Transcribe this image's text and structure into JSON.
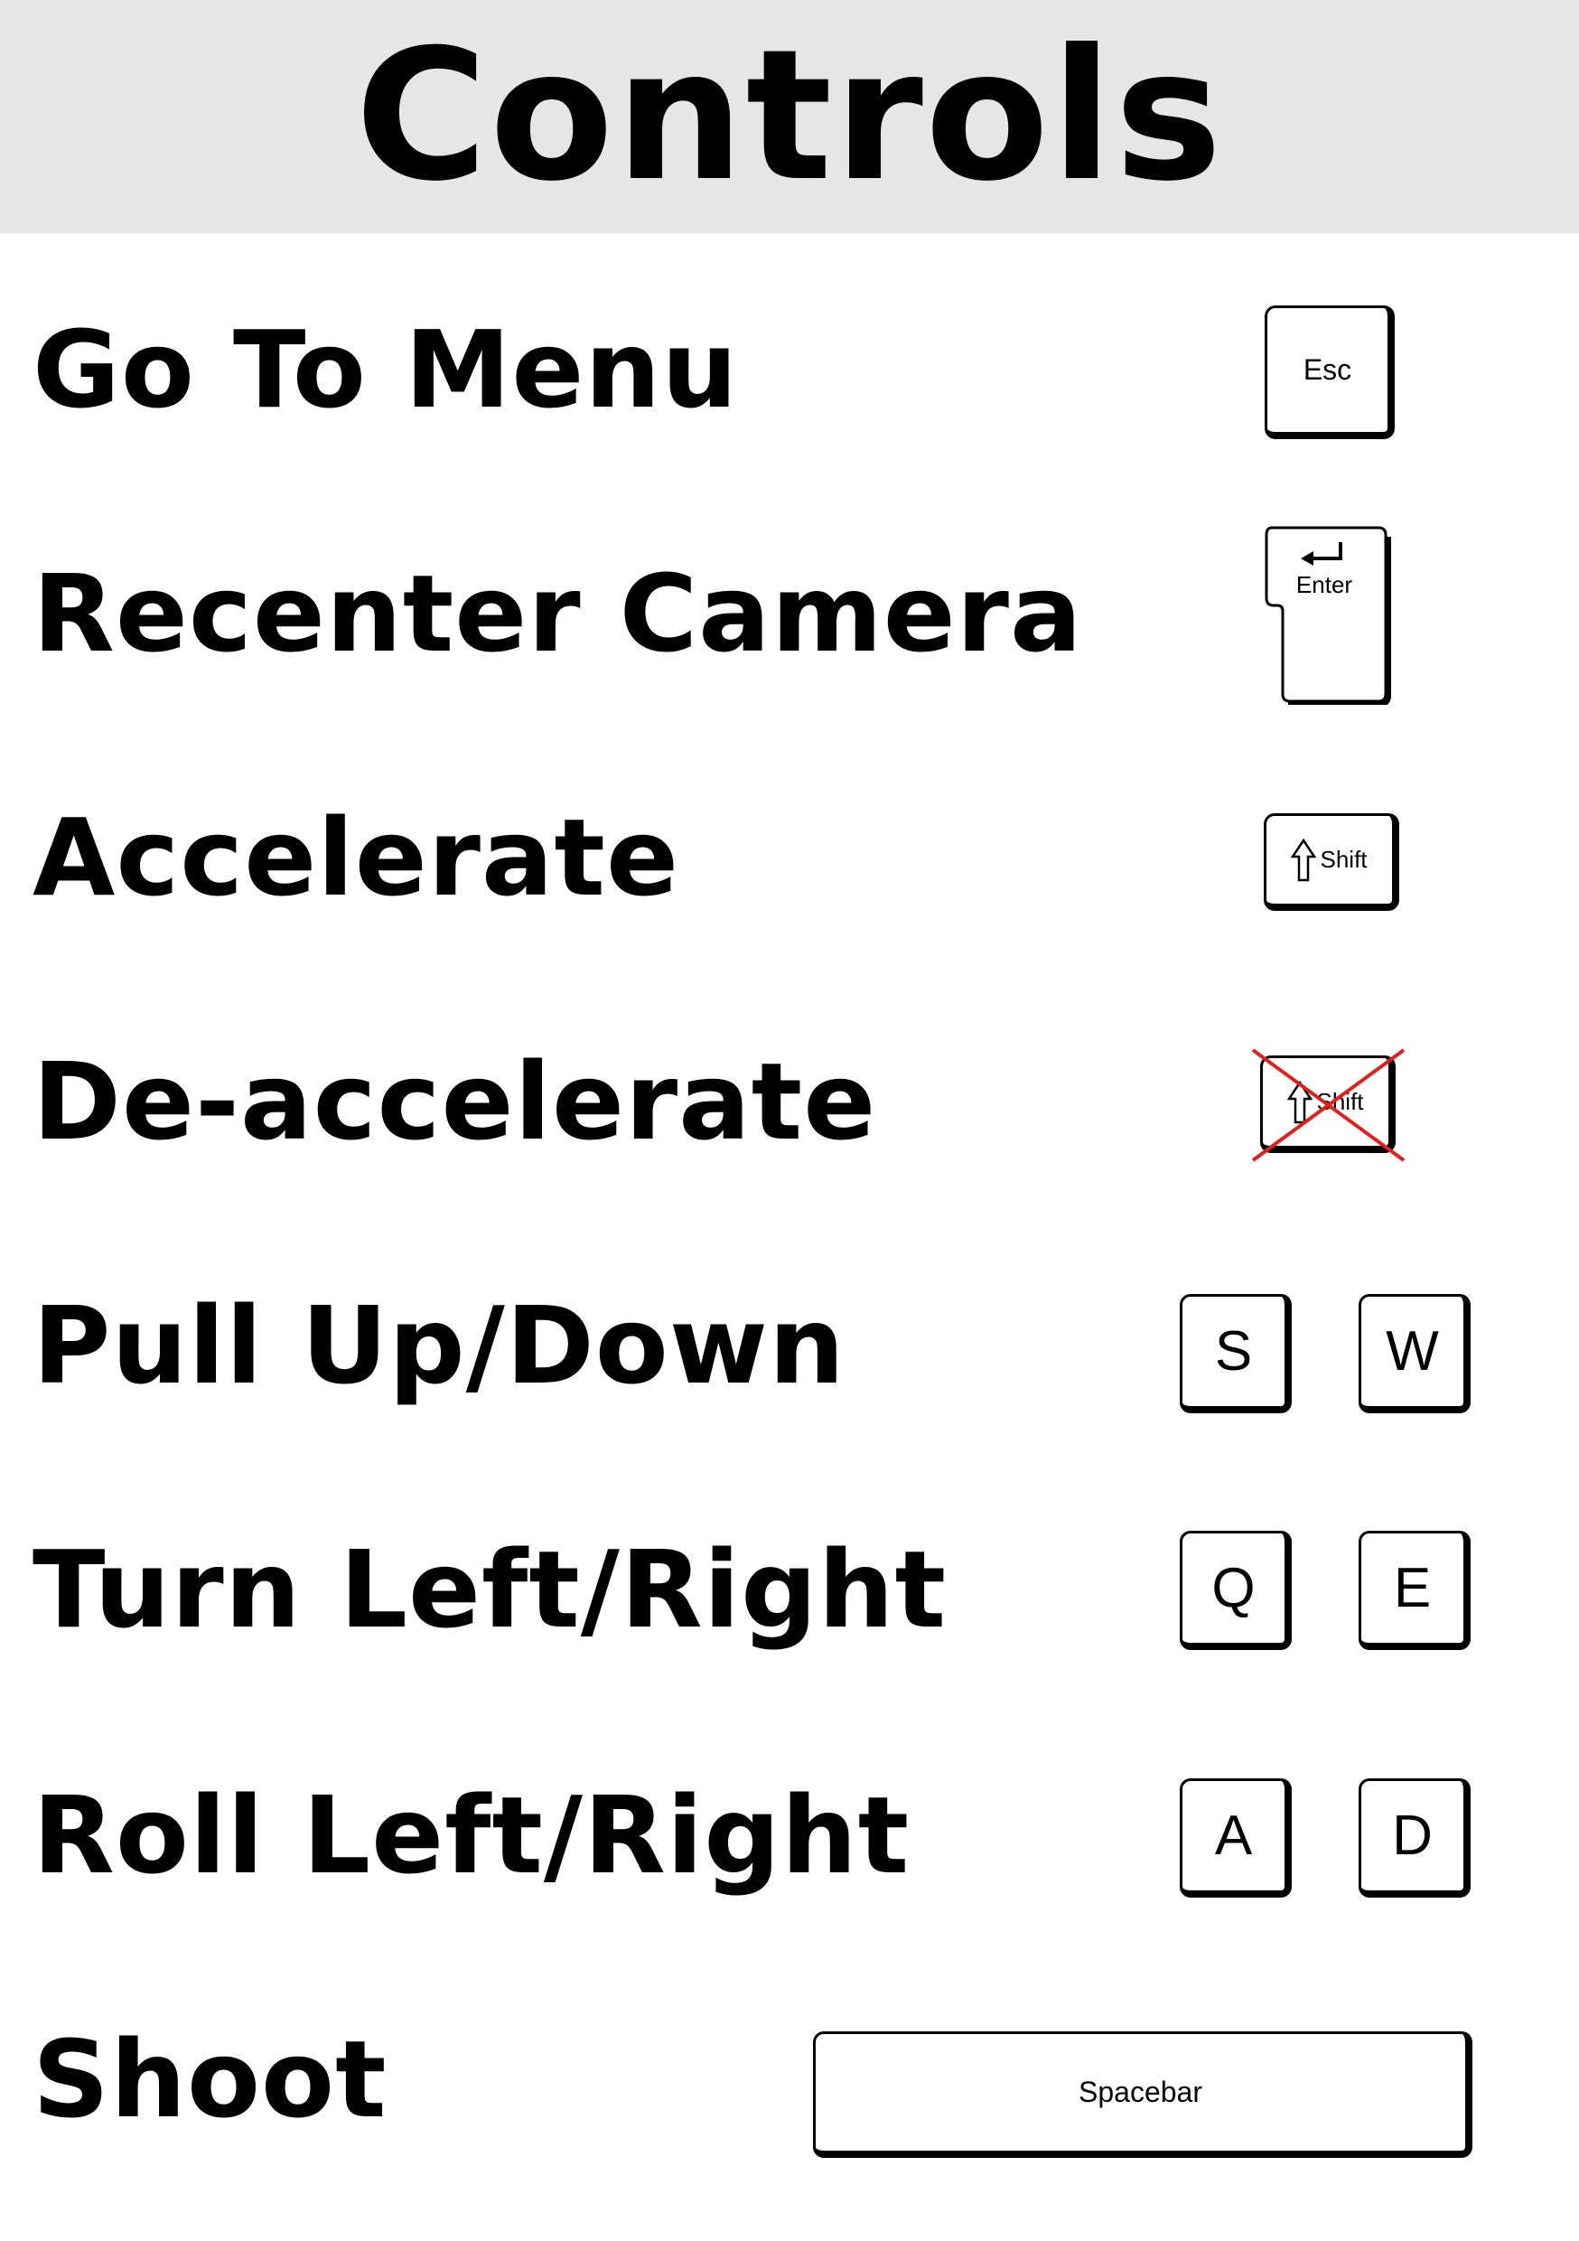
{
  "title": "Controls",
  "rows": [
    {
      "label": "Go To Menu",
      "keys": [
        "Esc"
      ]
    },
    {
      "label": "Recenter Camera",
      "keys": [
        "Enter"
      ]
    },
    {
      "label": "Accelerate",
      "keys": [
        "Shift"
      ]
    },
    {
      "label": "De-accelerate",
      "keys": [
        "Shift"
      ],
      "crossed_out": true
    },
    {
      "label": "Pull Up/Down",
      "keys": [
        "S",
        "W"
      ]
    },
    {
      "label": "Turn Left/Right",
      "keys": [
        "Q",
        "E"
      ]
    },
    {
      "label": "Roll Left/Right",
      "keys": [
        "A",
        "D"
      ]
    },
    {
      "label": "Shoot",
      "keys": [
        "Spacebar"
      ]
    }
  ],
  "icons": {
    "enter": "enter-arrow-icon",
    "shift": "shift-arrow-icon",
    "cross": "red-cross-icon"
  },
  "colors": {
    "header_bg": "#e6e6e6",
    "cross": "#e0201e"
  }
}
